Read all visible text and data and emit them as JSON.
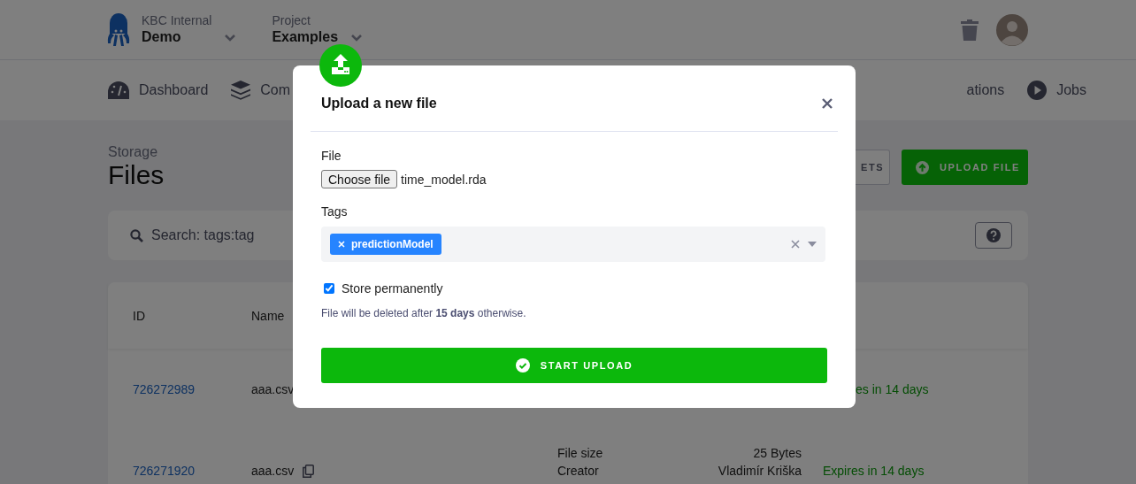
{
  "header": {
    "org_label": "KBC Internal",
    "org": "Demo",
    "project_label": "Project",
    "project": "Examples"
  },
  "nav": [
    {
      "label": "Dashboard"
    },
    {
      "label": "Com"
    },
    {
      "label": "ations"
    },
    {
      "label": "Jobs"
    }
  ],
  "page": {
    "section": "Storage",
    "title": "Files",
    "buttons": [
      {
        "label": "ETS",
        "kind": "outline"
      },
      {
        "label": "UPLOAD FILE",
        "kind": "primary"
      }
    ]
  },
  "search": {
    "placeholder": "Search: tags:tag"
  },
  "table": {
    "columns": [
      "ID",
      "Name"
    ],
    "rows": [
      {
        "id": "726272989",
        "name": "aaa.csv",
        "copy_icon": false,
        "details": [],
        "expiry": "es in 14 days"
      },
      {
        "id": "726271920",
        "name": "aaa.csv",
        "copy_icon": true,
        "details": [
          {
            "label": "File size",
            "value": "25 Bytes"
          },
          {
            "label": "Creator",
            "value": "Vladimír Kriška"
          }
        ],
        "expiry": "Expires in 14 days"
      }
    ]
  },
  "modal": {
    "title": "Upload a new file",
    "file_label": "File",
    "file_button": "Choose file",
    "file_name": "time_model.rda",
    "tags_label": "Tags",
    "tags": [
      "predictionModel"
    ],
    "store": {
      "label": "Store permanently",
      "checked": true
    },
    "hint": "File will be deleted after **15 days** otherwise.",
    "submit": "START UPLOAD"
  }
}
